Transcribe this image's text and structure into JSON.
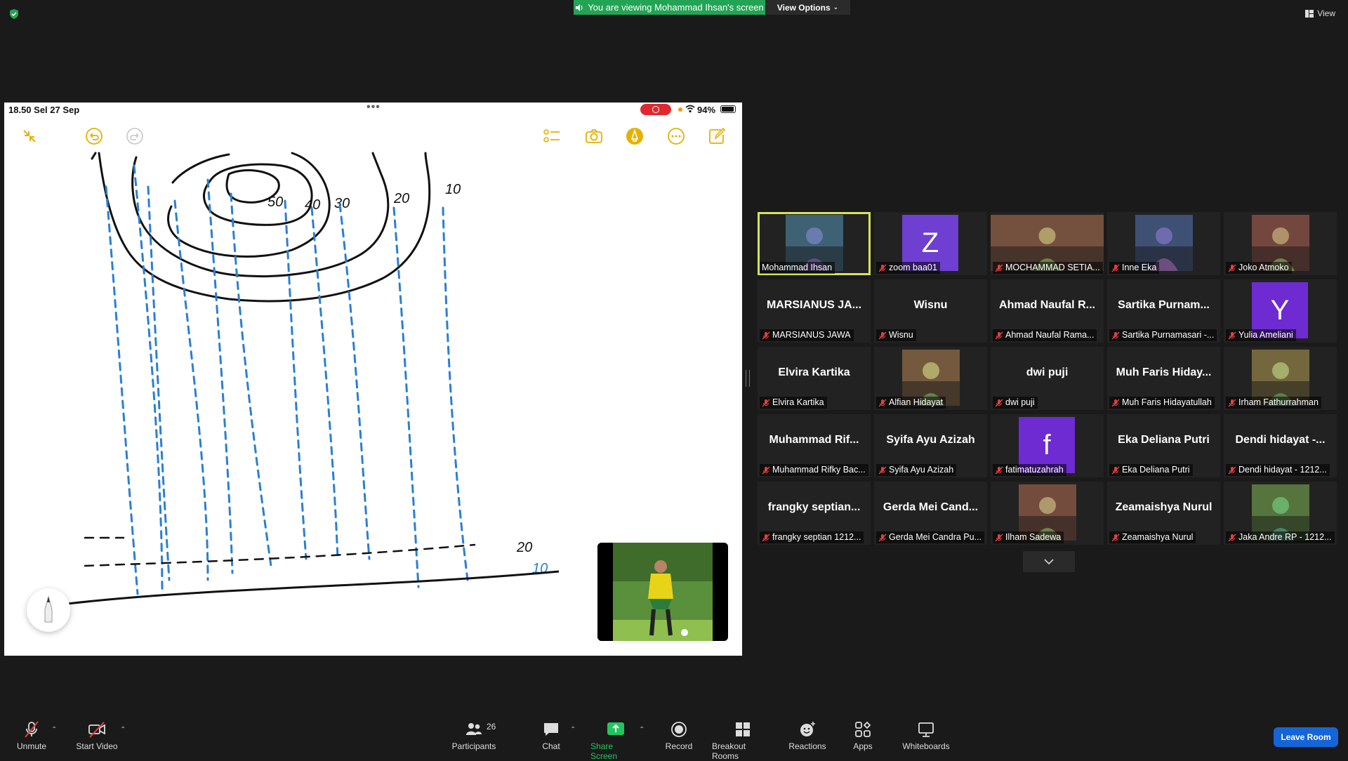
{
  "banner": {
    "text": "You are viewing Mohammad Ihsan's screen",
    "view_options": "View Options",
    "view": "View"
  },
  "shared_screen": {
    "status_time": "18.50  Sel 27 Sep",
    "battery": "94%",
    "contour_labels": [
      "50",
      "40",
      "30",
      "20",
      "10",
      "20",
      "10"
    ]
  },
  "gallery": [
    {
      "name": "Mohammad Ihsan",
      "display": "",
      "type": "photo",
      "active": true,
      "muted": false
    },
    {
      "name": "zoom baa01",
      "display": "Z",
      "type": "letter",
      "color": "#6e3fd1",
      "muted": true
    },
    {
      "name": "MOCHAMMAD SETIA...",
      "display": "",
      "type": "photo",
      "muted": true
    },
    {
      "name": "Inne Eka",
      "display": "",
      "type": "photo",
      "muted": true
    },
    {
      "name": "Joko Atmoko",
      "display": "",
      "type": "photo",
      "muted": true
    },
    {
      "name": "MARSIANUS JAWA",
      "display": "MARSIANUS JA...",
      "type": "text",
      "muted": true
    },
    {
      "name": "Wisnu",
      "display": "Wisnu",
      "type": "text",
      "muted": true
    },
    {
      "name": "Ahmad Naufal Rama...",
      "display": "Ahmad Naufal R...",
      "type": "text",
      "muted": true
    },
    {
      "name": "Sartika Purnamasari -...",
      "display": "Sartika Purnam...",
      "type": "text",
      "muted": true
    },
    {
      "name": "Yulia Ameliani",
      "display": "Y",
      "type": "letter",
      "color": "#6e2bd1",
      "muted": true
    },
    {
      "name": "Elvira Kartika",
      "display": "Elvira Kartika",
      "type": "text",
      "muted": true
    },
    {
      "name": "Alfian Hidayat",
      "display": "",
      "type": "photo",
      "muted": true
    },
    {
      "name": "dwi puji",
      "display": "dwi puji",
      "type": "text",
      "muted": true
    },
    {
      "name": "Muh Faris Hidayatullah",
      "display": "Muh Faris Hiday...",
      "type": "text",
      "muted": true
    },
    {
      "name": "Irham Fathurrahman",
      "display": "",
      "type": "photo",
      "muted": true
    },
    {
      "name": "Muhammad Rifky Bac...",
      "display": "Muhammad Rif...",
      "type": "text",
      "muted": true
    },
    {
      "name": "Syifa Ayu Azizah",
      "display": "Syifa Ayu Azizah",
      "type": "text",
      "muted": true
    },
    {
      "name": "fatimatuzahrah",
      "display": "f",
      "type": "letter",
      "color": "#6e2bd1",
      "muted": true
    },
    {
      "name": "Eka Deliana Putri",
      "display": "Eka Deliana Putri",
      "type": "text",
      "muted": true
    },
    {
      "name": "Dendi hidayat - 1212...",
      "display": "Dendi hidayat -...",
      "type": "text",
      "muted": true
    },
    {
      "name": "frangky septian 1212...",
      "display": "frangky septian...",
      "type": "text",
      "muted": true
    },
    {
      "name": "Gerda Mei Candra Pu...",
      "display": "Gerda Mei Cand...",
      "type": "text",
      "muted": true
    },
    {
      "name": "Ilham Sadewa",
      "display": "",
      "type": "photo",
      "muted": true
    },
    {
      "name": "Zeamaishya Nurul",
      "display": "Zeamaishya Nurul",
      "type": "text",
      "muted": true
    },
    {
      "name": "Jaka Andre RP - 1212...",
      "display": "",
      "type": "photo",
      "muted": true
    }
  ],
  "toolbar": {
    "unmute": "Unmute",
    "start_video": "Start Video",
    "participants": "Participants",
    "participants_count": "26",
    "chat": "Chat",
    "share_screen": "Share Screen",
    "record": "Record",
    "breakout_rooms": "Breakout Rooms",
    "reactions": "Reactions",
    "apps": "Apps",
    "whiteboards": "Whiteboards",
    "leave_room": "Leave Room"
  },
  "colors": {
    "banner_green": "#23a455",
    "leave_blue": "#1565d8",
    "active_border": "#d7e35a",
    "ink_blue": "#2a7fd4"
  }
}
